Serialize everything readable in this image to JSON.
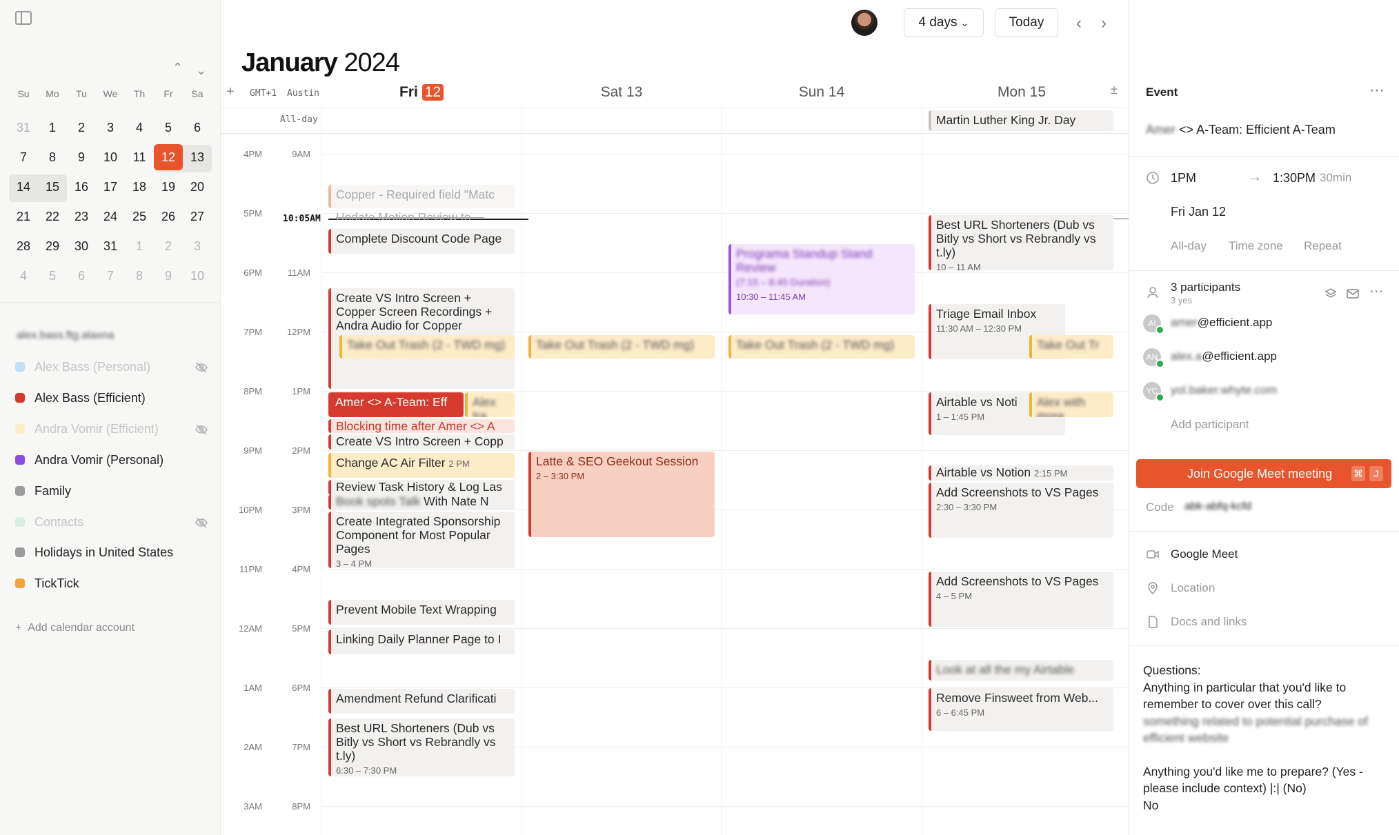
{
  "sidebar": {
    "mini_cal": {
      "weekdays": [
        "Su",
        "Mo",
        "Tu",
        "We",
        "Th",
        "Fr",
        "Sa"
      ],
      "weeks": [
        [
          "31",
          "1",
          "2",
          "3",
          "4",
          "5",
          "6"
        ],
        [
          "7",
          "8",
          "9",
          "10",
          "11",
          "12",
          "13"
        ],
        [
          "14",
          "15",
          "16",
          "17",
          "18",
          "19",
          "20"
        ],
        [
          "21",
          "22",
          "23",
          "24",
          "25",
          "26",
          "27"
        ],
        [
          "28",
          "29",
          "30",
          "31",
          "1",
          "2",
          "3"
        ],
        [
          "4",
          "5",
          "6",
          "7",
          "8",
          "9",
          "10"
        ]
      ],
      "prev_icon": "chevron-up-icon",
      "next_icon": "chevron-down-icon"
    },
    "account_email": "alex.bass.ftg.alaxna",
    "calendars": [
      {
        "label": "Alex Bass (Personal)",
        "color": "#bfe0f5",
        "hidden": true
      },
      {
        "label": "Alex Bass (Efficient)",
        "color": "#d63a2f",
        "hidden": false
      },
      {
        "label": "Andra Vomir (Efficient)",
        "color": "#fbedc3",
        "hidden": true
      },
      {
        "label": "Andra Vomir (Personal)",
        "color": "#8a4fe0",
        "hidden": false
      },
      {
        "label": "Family",
        "color": "#9c9c9c",
        "hidden": false
      },
      {
        "label": "Contacts",
        "color": "#d9eee2",
        "hidden": true
      },
      {
        "label": "Holidays in United States",
        "color": "#9c9c9c",
        "hidden": false
      },
      {
        "label": "TickTick",
        "color": "#f0a43a",
        "hidden": false
      }
    ],
    "add_account": "Add calendar account"
  },
  "header": {
    "view_select": "4 days",
    "today_button": "Today",
    "month": "January",
    "year": "2024"
  },
  "grid": {
    "tz_primary": "GMT+1",
    "tz_secondary": "Austin",
    "allday_label": "All-day",
    "days": [
      {
        "name": "Fri",
        "num": "12",
        "today": true
      },
      {
        "name": "Sat",
        "num": "13",
        "today": false
      },
      {
        "name": "Sun",
        "num": "14",
        "today": false
      },
      {
        "name": "Mon",
        "num": "15",
        "today": false
      }
    ],
    "hours_primary": [
      "4PM",
      "5PM",
      "6PM",
      "7PM",
      "8PM",
      "9PM",
      "10PM",
      "11PM",
      "12AM",
      "1AM",
      "2AM",
      "3AM"
    ],
    "hours_secondary": [
      "9AM",
      "10:05AM",
      "11AM",
      "12PM",
      "1PM",
      "2PM",
      "3PM",
      "4PM",
      "5PM",
      "6PM",
      "7PM",
      "8PM"
    ],
    "now_label": "10:05AM",
    "holiday": "Martin Luther King Jr. Day",
    "events": {
      "copper": "Copper - Required field \"Matc",
      "update_motion": "Update Motion Review to ...",
      "discount": "Complete Discount Code Page",
      "intro_screen": "Create VS Intro Screen + Copper Screen Recordings + Andra Audio for Copper",
      "take_out": "Take Out Trash (2 - TWD mg)",
      "ateam": "Amer <> A-Team: Eff",
      "ateam_side": "Alex tra",
      "blocking": "Blocking time after Amer <> A",
      "intro_screen2": "Create VS Intro Screen + Copp",
      "ac_filter": "Change AC Air Filter",
      "ac_filter_time": "2 PM",
      "review_task": "Review Task History & Log Las",
      "meeting_nate": "With Nate N",
      "meeting_nate_blur": "Book spots Talk",
      "sponsorship": "Create Integrated Sponsorship Component for Most Popular Pages",
      "sponsorship_time": "3 – 4 PM",
      "mobile_text": "Prevent Mobile Text Wrapping",
      "linking": "Linking Daily Planner Page to I",
      "amendment": "Amendment Refund Clarificati",
      "url_short_fri": "Best URL Shorteners (Dub vs Bitly vs Short vs Rebrandly vs t.ly)",
      "url_short_fri_time": "6:30 – 7:30 PM",
      "latte": "Latte & SEO Geekout Session",
      "latte_time": "2 – 3:30 PM",
      "purple": "Programa Standup Stand Review",
      "purple_sub": "(7:15 – 8:45 Duration)",
      "purple_time": "10:30 – 11:45 AM",
      "url_short_mon": "Best URL Shorteners (Dub vs Bitly vs Short vs Rebrandly vs t.ly)",
      "url_short_mon_time": "10 – 11 AM",
      "triage": "Triage Email Inbox",
      "triage_time": "11:30 AM – 12:30 PM",
      "take_out_short": "Take Out Tr",
      "airtable_noti": "Airtable vs Noti",
      "airtable_noti_time": "1 – 1:45 PM",
      "airtable_side": "Alex with more",
      "airtable_notion": "Airtable vs Notion",
      "airtable_notion_time": "2:15 PM",
      "screenshots1": "Add Screenshots to VS Pages",
      "screenshots1_time": "2:30 – 3:30 PM",
      "screenshots2": "Add Screenshots to VS Pages",
      "screenshots2_time": "4 – 5 PM",
      "mon_blur": "Look at all the my Airtable",
      "finsweet": "Remove Finsweet from Web...",
      "finsweet_time": "6 – 6:45 PM"
    }
  },
  "panel": {
    "title": "Event",
    "event_title_blur": "Amer",
    "event_title": "<> A-Team: Efficient A-Team",
    "start_time": "1PM",
    "end_time": "1:30PM",
    "duration": "30min",
    "date": "Fri Jan 12",
    "options": [
      "All-day",
      "Time zone",
      "Repeat"
    ],
    "participants_count": "3 participants",
    "participants_yes": "3 yes",
    "participants": [
      {
        "initials": "AI",
        "email_blur": "amer",
        "email": "@efficient.app",
        "color": "#c9c9c9"
      },
      {
        "initials": "AN",
        "email_blur": "alex.a",
        "email": "@efficient.app",
        "color": "#c9c9c9"
      },
      {
        "initials": "YC",
        "email_blur": "yol.baker.whyte.com",
        "email": "",
        "color": "#c9c9c9"
      }
    ],
    "add_participant": "Add participant",
    "join_meet": "Join Google Meet meeting",
    "kbd1": "⌘",
    "kbd2": "J",
    "code_label": "Code",
    "code_value": "abk-abfq-kcfd",
    "google_meet": "Google Meet",
    "location": "Location",
    "docs": "Docs and links",
    "notes": {
      "line1": "Questions:",
      "line2": "Anything in particular that you'd like to remember to cover over this call?",
      "line3_blur": "something related to potential purchase of efficient website",
      "line4": "Anything you'd like me to prepare? (Yes - please include context) |:| (No)",
      "line5": "No"
    }
  }
}
